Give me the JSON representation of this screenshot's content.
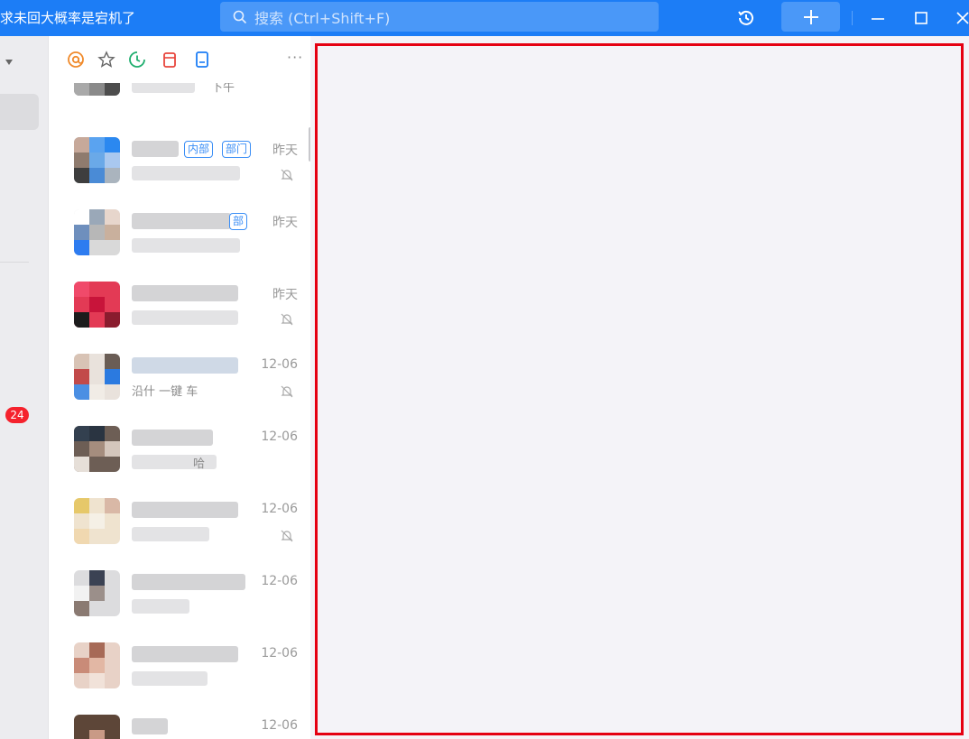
{
  "titlebar": {
    "title": "求未回大概率是宕机了",
    "search_placeholder": "搜索 (Ctrl+Shift+F)",
    "icons": [
      "search-icon",
      "history-icon",
      "plus-icon",
      "minimize-icon",
      "maximize-icon",
      "close-icon"
    ]
  },
  "left": {
    "badge_count": "24"
  },
  "toolbar": {
    "icons": [
      "at-mention-icon",
      "star-icon",
      "clock-icon",
      "calendar-icon",
      "document-icon"
    ],
    "more": "···"
  },
  "chats": [
    {
      "time": "",
      "name_text": "下午",
      "msg_text": "",
      "muted": false
    },
    {
      "time": "昨天",
      "tags": [
        "内部",
        "部门"
      ],
      "name_text": "",
      "msg_text": "",
      "muted": true
    },
    {
      "time": "昨天",
      "tags": [
        "部"
      ],
      "name_text": "",
      "msg_text": "",
      "muted": false
    },
    {
      "time": "昨天",
      "name_text": "",
      "msg_text": "",
      "muted": true
    },
    {
      "time": "12-06",
      "name_text": "",
      "msg_text": "沿什     一键     车",
      "muted": true
    },
    {
      "time": "12-06",
      "name_text": "",
      "msg_text": "哈",
      "muted": false
    },
    {
      "time": "12-06",
      "name_text": "",
      "msg_text": "",
      "muted": true
    },
    {
      "time": "12-06",
      "name_text": "",
      "msg_text": "",
      "muted": false
    },
    {
      "time": "12-06",
      "name_text": "",
      "msg_text": "",
      "muted": false
    },
    {
      "time": "12-06",
      "name_text": "",
      "msg_text": "",
      "muted": false
    }
  ],
  "colors": {
    "accent": "#1c7df6",
    "highlight_frame": "#e50012",
    "badge": "#f5222d"
  }
}
